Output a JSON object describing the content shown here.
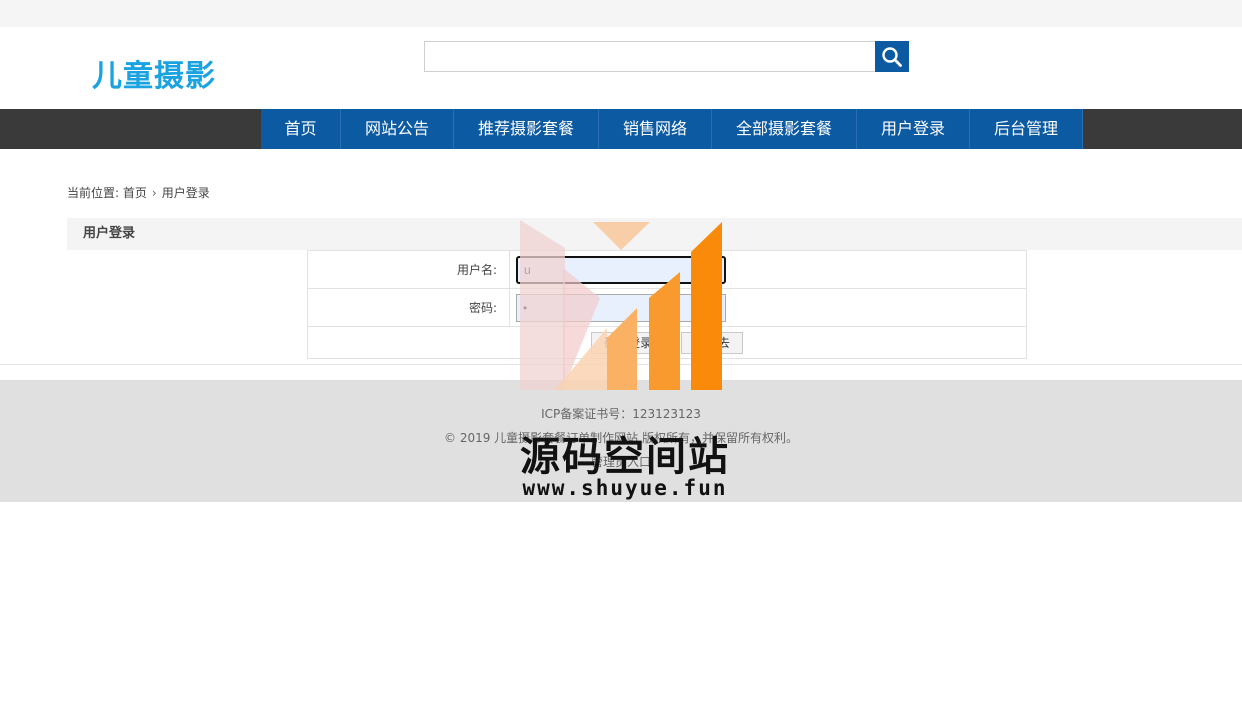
{
  "header": {
    "logo": "儿童摄影",
    "search": {
      "value": "",
      "placeholder": ""
    }
  },
  "nav": {
    "items": [
      "首页",
      "网站公告",
      "推荐摄影套餐",
      "销售网络",
      "全部摄影套餐",
      "用户登录",
      "后台管理"
    ]
  },
  "breadcrumb": {
    "prefix": "当前位置:",
    "home": "首页",
    "sep": "›",
    "current": "用户登录"
  },
  "panel": {
    "title": "用户登录"
  },
  "form": {
    "username_label": "用户名:",
    "username_value": "u",
    "password_label": "密码:",
    "password_value": "•",
    "submit_label": "确认登录",
    "register_label": "注册去"
  },
  "footer": {
    "icp": "ICP备案证书号：123123123",
    "copyright": "© 2019 儿童摄影套餐订单制作网站 版权所有，并保留所有权利。",
    "admin_link": "管理员入口"
  },
  "watermark": {
    "title": "源码空间站",
    "url": "www.shuyue.fun"
  },
  "colors": {
    "brand_blue": "#0b5aa2",
    "logo_blue": "#1aa3e0",
    "nav_bg": "#3a3a3a",
    "footer_bg": "#e0e0e0"
  }
}
